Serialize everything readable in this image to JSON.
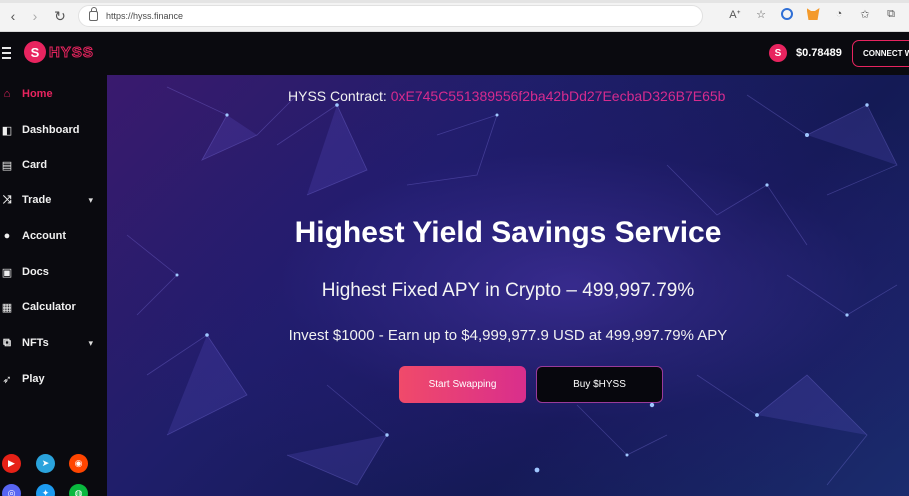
{
  "browser": {
    "url": "https://hyss.finance"
  },
  "header": {
    "logo_letter": "S",
    "logo_text": "HYSS",
    "price_letter": "S",
    "price": "$0.78489",
    "connect_label": "CONNECT W"
  },
  "sidebar": {
    "items": [
      {
        "label": "Home",
        "icon": "home-icon",
        "active": true
      },
      {
        "label": "Dashboard",
        "icon": "dashboard-icon"
      },
      {
        "label": "Card",
        "icon": "card-icon"
      },
      {
        "label": "Trade",
        "icon": "shuffle-icon",
        "has_submenu": true
      },
      {
        "label": "Account",
        "icon": "user-icon"
      },
      {
        "label": "Docs",
        "icon": "docs-icon"
      },
      {
        "label": "Calculator",
        "icon": "calculator-icon"
      },
      {
        "label": "NFTs",
        "icon": "nft-icon",
        "has_submenu": true
      },
      {
        "label": "Play",
        "icon": "rocket-icon"
      }
    ],
    "socials": [
      {
        "name": "youtube-icon",
        "color": "#e62117"
      },
      {
        "name": "telegram-icon",
        "color": "#2aa3dc"
      },
      {
        "name": "reddit-icon",
        "color": "#ff4500"
      },
      {
        "name": "discord-icon",
        "color": "#5865f2"
      },
      {
        "name": "twitter-icon",
        "color": "#1d9bf0"
      },
      {
        "name": "wechat-icon",
        "color": "#09b83e"
      }
    ]
  },
  "hero": {
    "contract_label": "HYSS Contract:",
    "contract_address": "0xE745C551389556f2ba42bDd27EecbaD326B7E65b",
    "headline": "Highest Yield Savings Service",
    "subhead": "Highest Fixed APY in Crypto – 499,997.79%",
    "invest_line": "Invest $1000 - Earn up to $4,999,977.9 USD at 499,997.79% APY",
    "primary_button": "Start Swapping",
    "secondary_button": "Buy $HYSS"
  },
  "colors": {
    "brand_pink": "#e8245f",
    "contract_pink": "#d62b8e",
    "header_bg": "#0a0a0f"
  }
}
